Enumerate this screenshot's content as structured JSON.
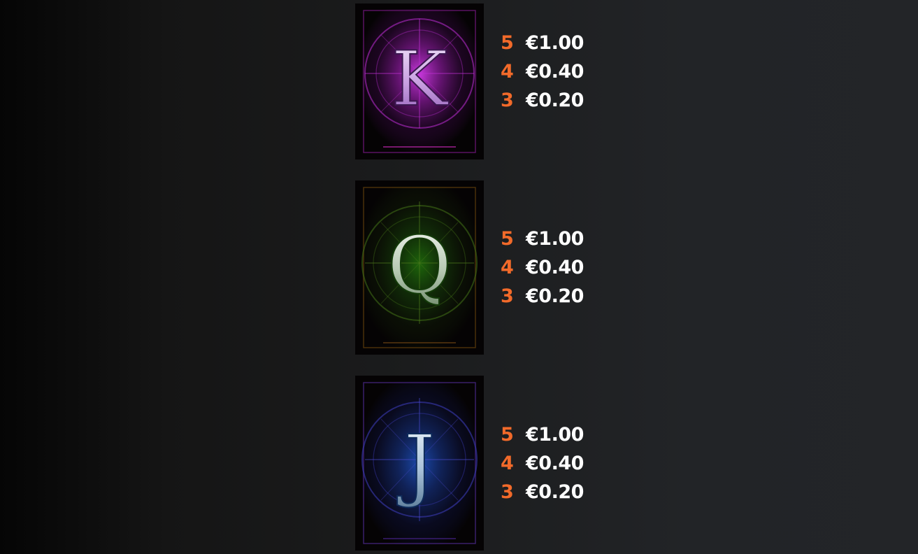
{
  "symbols": [
    {
      "letter": "K",
      "theme": "purple",
      "colors": {
        "glow": "#c12ad6",
        "letter": "#d8b7ec",
        "frame": "#4a0f4f"
      },
      "payouts": [
        {
          "count": "5",
          "amount": "€1.00"
        },
        {
          "count": "4",
          "amount": "€0.40"
        },
        {
          "count": "3",
          "amount": "€0.20"
        }
      ]
    },
    {
      "letter": "Q",
      "theme": "green",
      "colors": {
        "glow": "#2c8a14",
        "letter": "#c9d9c6",
        "frame": "#3b2a08"
      },
      "payouts": [
        {
          "count": "5",
          "amount": "€1.00"
        },
        {
          "count": "4",
          "amount": "€0.40"
        },
        {
          "count": "3",
          "amount": "€0.20"
        }
      ]
    },
    {
      "letter": "J",
      "theme": "blue",
      "colors": {
        "glow": "#1f5bc9",
        "letter": "#c3d7ea",
        "frame": "#2a1a52"
      },
      "payouts": [
        {
          "count": "5",
          "amount": "€1.00"
        },
        {
          "count": "4",
          "amount": "€0.40"
        },
        {
          "count": "3",
          "amount": "€0.20"
        }
      ]
    }
  ],
  "colors": {
    "count_accent": "#f26a2a",
    "amount_text": "#ffffff",
    "background": "#1b1c1d"
  }
}
